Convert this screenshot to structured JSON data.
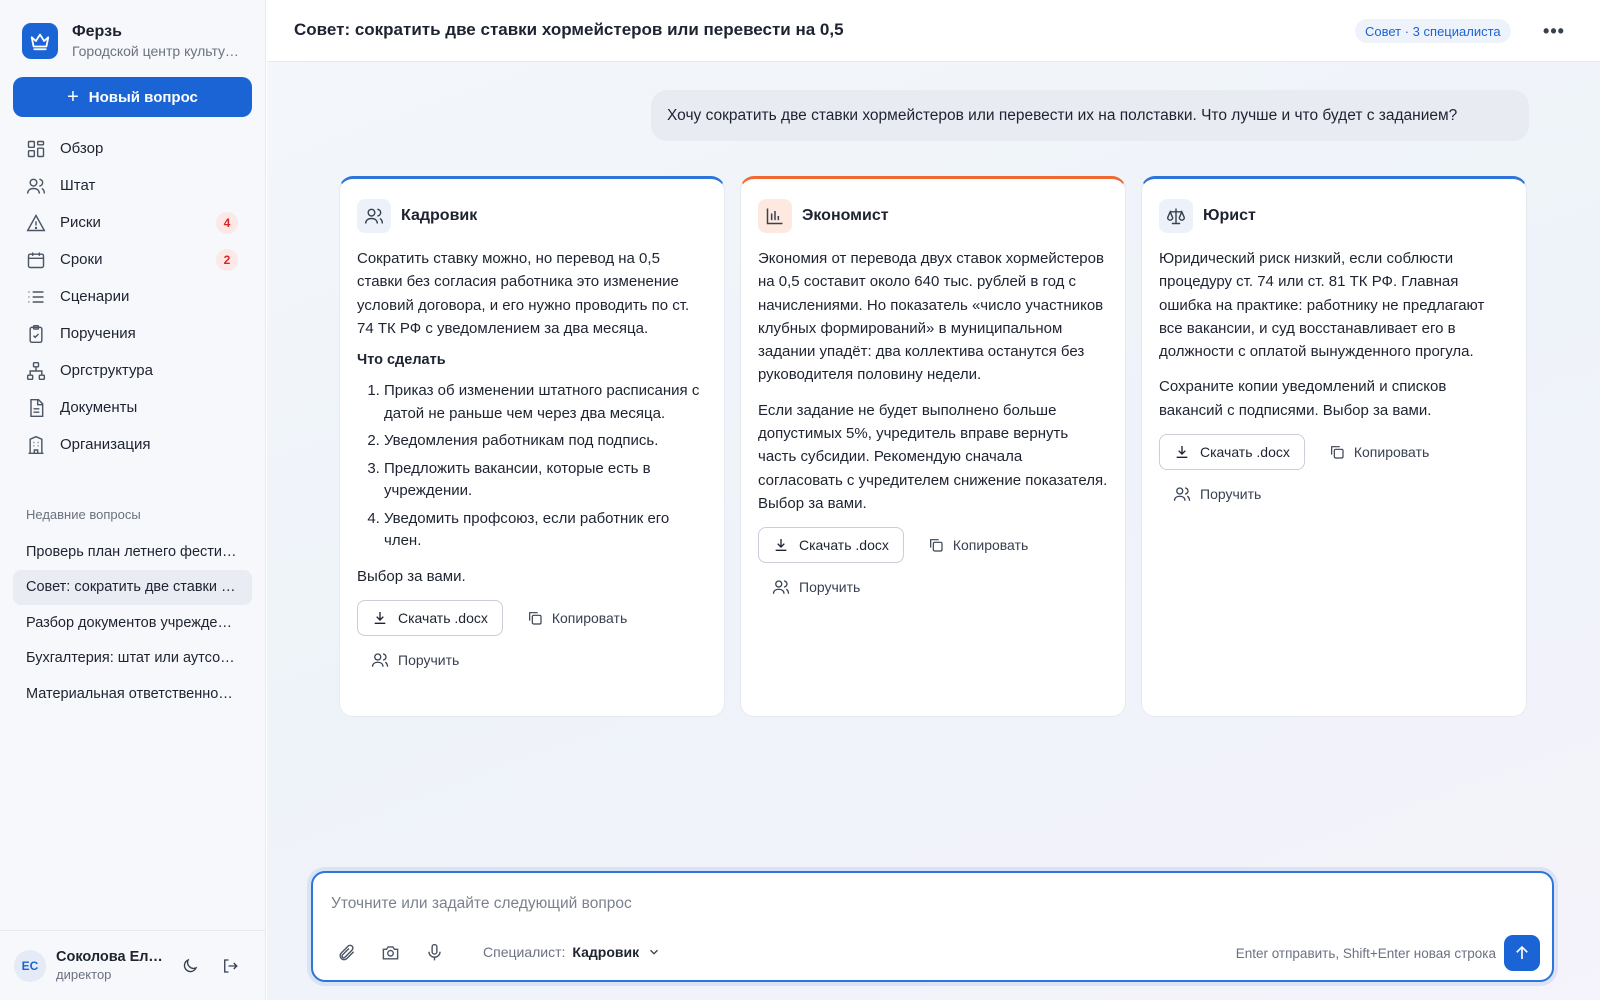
{
  "app": {
    "name": "Ферзь",
    "subtitle": "Городской центр культуры и досуга"
  },
  "sidebar": {
    "new_question": "Новый вопрос",
    "nav": [
      {
        "label": "Обзор",
        "icon": "grid-icon"
      },
      {
        "label": "Штат",
        "icon": "users-icon"
      },
      {
        "label": "Риски",
        "icon": "warning-icon",
        "badge": "4"
      },
      {
        "label": "Сроки",
        "icon": "calendar-icon",
        "badge": "2"
      },
      {
        "label": "Сценарии",
        "icon": "list-icon"
      },
      {
        "label": "Поручения",
        "icon": "clipboard-icon"
      },
      {
        "label": "Оргструктура",
        "icon": "org-icon"
      },
      {
        "label": "Документы",
        "icon": "document-icon"
      },
      {
        "label": "Организация",
        "icon": "building-icon"
      }
    ],
    "recent_title": "Недавние вопросы",
    "recent": [
      "Проверь план летнего фестиваля",
      "Совет: сократить две ставки хормейстеров",
      "Разбор документов учреждения",
      "Бухгалтерия: штат или аутсорсинг",
      "Материальная ответственность"
    ],
    "user": {
      "initials": "ЕС",
      "name": "Соколова Елена",
      "role": "директор"
    }
  },
  "header": {
    "title": "Совет: сократить две ставки хормейстеров или перевести на 0,5",
    "pill": "Совет · 3 специалиста",
    "more": "•••"
  },
  "question": "Хочу сократить две ставки хормейстеров или перевести их на полставки. Что лучше и что будет с заданием?",
  "cards": [
    {
      "title": "Кадровик",
      "icon": "users-icon",
      "p1": "Сократить ставку можно, но перевод на 0,5 ставки без согласия работника это изменение условий договора, и его нужно проводить по ст. 74 ТК РФ с уведомлением за два месяца.",
      "subhead": "Что сделать",
      "steps": [
        "Приказ об изменении штатного расписания с датой не раньше чем через два месяца.",
        "Уведомления работникам под подпись.",
        "Предложить вакансии, которые есть в учреждении.",
        "Уведомить профсоюз, если работник его член."
      ],
      "p2": "Выбор за вами."
    },
    {
      "title": "Экономист",
      "icon": "chart-icon",
      "p1": "Экономия от перевода двух ставок хормейстеров на 0,5 составит около 640 тыс. рублей в год с начислениями. Но показатель «число участников клубных формирований» в муниципальном задании упадёт: два коллектива останутся без руководителя половину недели.",
      "p2": "Если задание не будет выполнено больше допустимых 5%, учредитель вправе вернуть часть субсидии. Рекомендую сначала согласовать с учредителем снижение показателя. Выбор за вами."
    },
    {
      "title": "Юрист",
      "icon": "scales-icon",
      "p1": "Юридический риск низкий, если соблюсти процедуру ст. 74 или ст. 81 ТК РФ. Главная ошибка на практике: работнику не предлагают все вакансии, и суд восстанавливает его в должности с оплатой вынужденного прогула.",
      "p2": "Сохраните копии уведомлений и списков вакансий с подписями. Выбор за вами."
    }
  ],
  "card_actions": {
    "download": "Скачать .docx",
    "copy": "Копировать",
    "assign": "Поручить"
  },
  "composer": {
    "placeholder": "Уточните или задайте следующий вопрос",
    "specialist_label": "Специалист:",
    "specialist_value": "Кадровик",
    "hint": "Enter отправить, Shift+Enter новая строка"
  },
  "colors": {
    "accent": "#1b64d6",
    "card_top_blue": "#2f74d8",
    "card_top_orange": "#ef6a32",
    "badge_red": "#dc2626"
  }
}
